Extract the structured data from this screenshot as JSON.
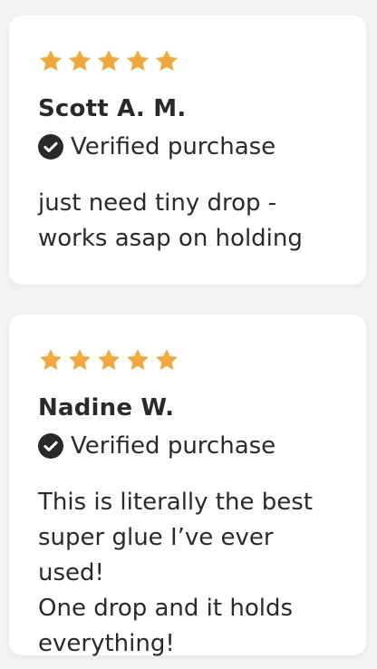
{
  "colors": {
    "star": "#F2A93B",
    "text": "#2A2A2A",
    "card_bg": "#FFFFFF",
    "page_bg": "#F3F3F1"
  },
  "reviews": [
    {
      "rating": 5,
      "name": "Scott A. M.",
      "verified_label": "Verified purchase",
      "body": "just need tiny drop -\nworks asap on holding"
    },
    {
      "rating": 5,
      "name": "Nadine W.",
      "verified_label": "Verified purchase",
      "body": "This is literally the best\nsuper glue I’ve ever used!\nOne drop and it holds\neverything!"
    }
  ]
}
